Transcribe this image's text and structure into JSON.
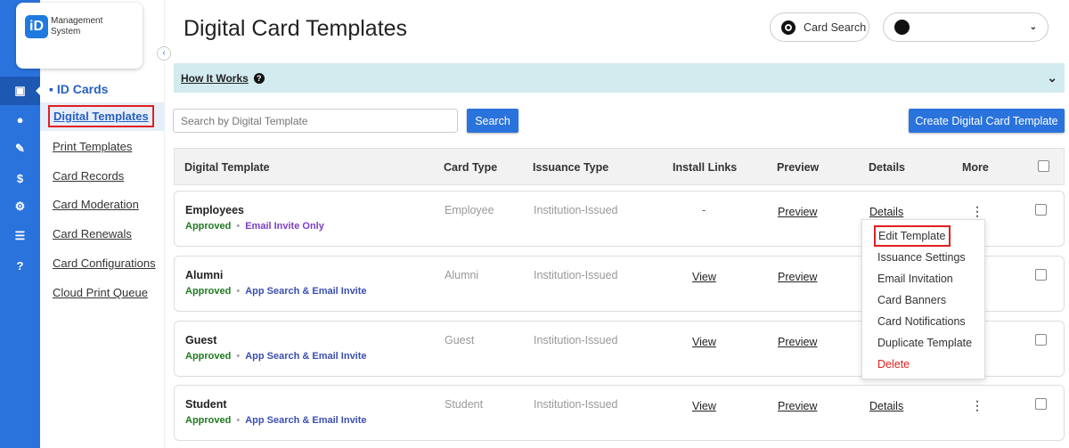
{
  "logo": {
    "line1": "Management",
    "line2": "System",
    "mark": "iD"
  },
  "iconbar": [
    "id-card-icon",
    "chat-icon",
    "plug-icon",
    "invoice-icon",
    "gear-icon",
    "list-icon",
    "help-icon"
  ],
  "subnav": {
    "heading": "ID Cards",
    "items": [
      "Digital Templates",
      "Print Templates",
      "Card Records",
      "Card Moderation",
      "Card Renewals",
      "Card Configurations",
      "Cloud Print Queue"
    ],
    "active": "Digital Templates"
  },
  "header": {
    "title": "Digital Card Templates",
    "card_search": "Card Search"
  },
  "how": {
    "label": "How It Works"
  },
  "search": {
    "placeholder": "Search by Digital Template",
    "button": "Search"
  },
  "create_button": "Create Digital Card Template",
  "table": {
    "columns": [
      "Digital Template",
      "Card Type",
      "Issuance Type",
      "Install Links",
      "Preview",
      "Details",
      "More"
    ],
    "rows": [
      {
        "name": "Employees",
        "status": "Approved",
        "mode": "Email Invite Only",
        "card_type": "Employee",
        "issuance": "Institution-Issued",
        "install": "-",
        "preview": "Preview",
        "details": "Details"
      },
      {
        "name": "Alumni",
        "status": "Approved",
        "mode": "App Search & Email Invite",
        "card_type": "Alumni",
        "issuance": "Institution-Issued",
        "install": "View",
        "preview": "Preview",
        "details": ""
      },
      {
        "name": "Guest",
        "status": "Approved",
        "mode": "App Search & Email Invite",
        "card_type": "Guest",
        "issuance": "Institution-Issued",
        "install": "View",
        "preview": "Preview",
        "details": ""
      },
      {
        "name": "Student",
        "status": "Approved",
        "mode": "App Search & Email Invite",
        "card_type": "Student",
        "issuance": "Institution-Issued",
        "install": "View",
        "preview": "Preview",
        "details": "Details"
      }
    ]
  },
  "menu": [
    "Edit Template",
    "Issuance Settings",
    "Email Invitation",
    "Card Banners",
    "Card Notifications",
    "Duplicate Template",
    "Delete"
  ],
  "colors": {
    "primary": "#2b73dc",
    "approved": "#1e7a1e",
    "email_only": "#7b3fc4",
    "app_search": "#3a4fb0",
    "delete": "#e02020"
  }
}
